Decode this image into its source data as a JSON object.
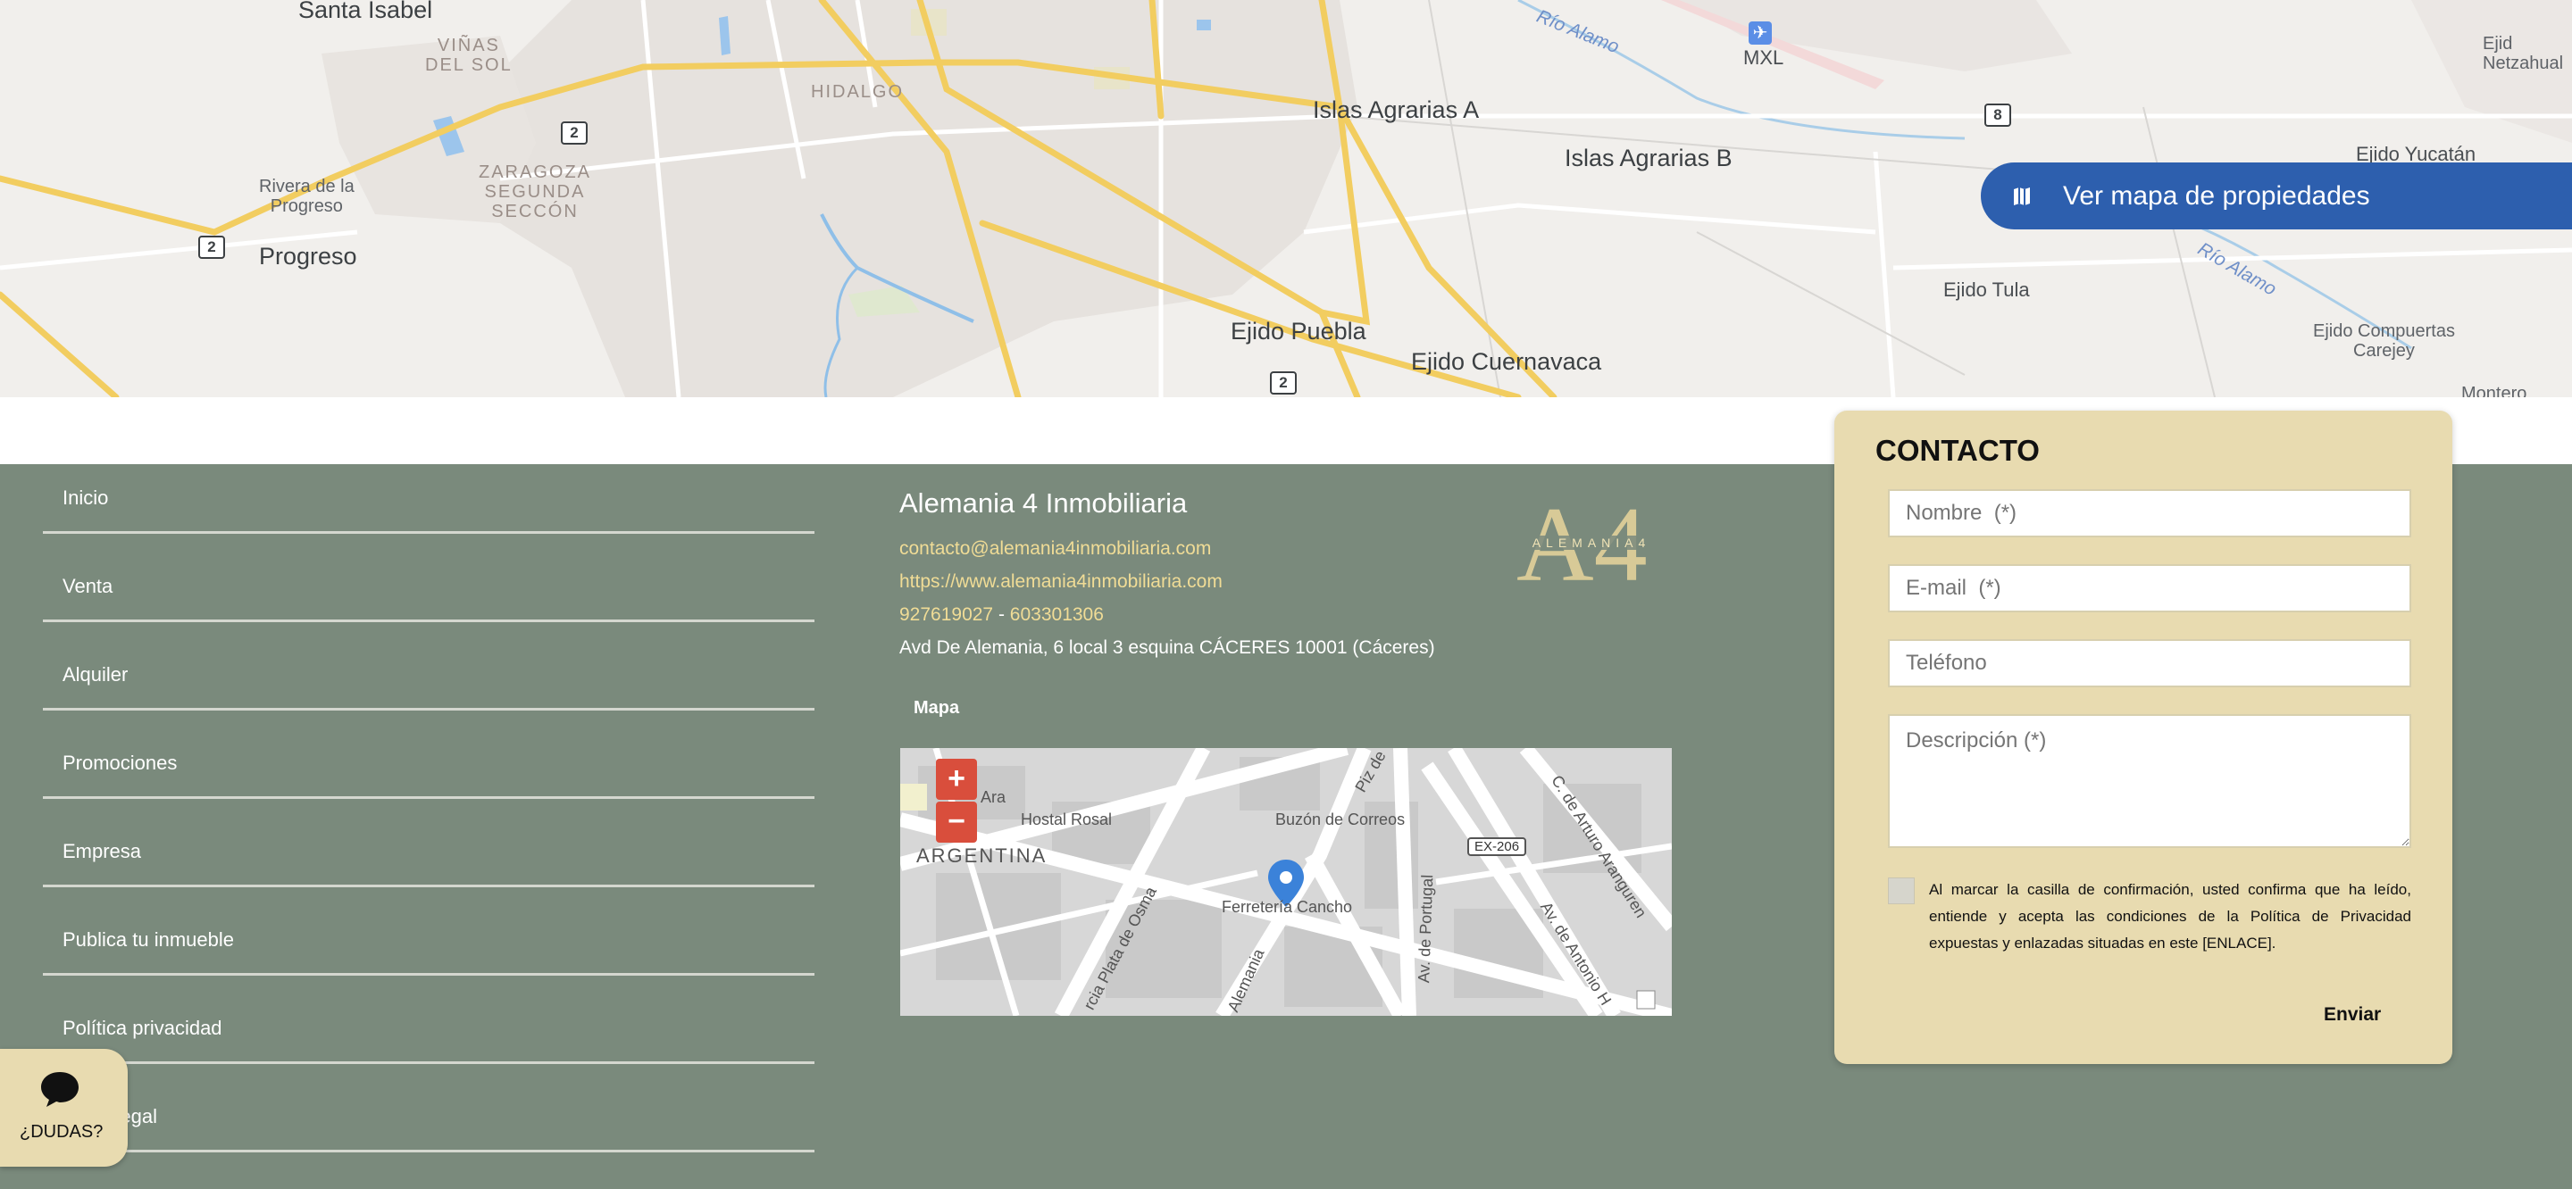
{
  "top_map": {
    "labels": {
      "santa_isabel": "Santa Isabel",
      "vinas_del_sol_1": "VIÑAS",
      "vinas_del_sol_2": "DEL SOL",
      "hidalgo": "HIDALGO",
      "rivera_1": "Rivera de la",
      "rivera_2": "Progreso",
      "zaragoza_1": "ZARAGOZA",
      "zaragoza_2": "SEGUNDA",
      "zaragoza_3": "SECCÓN",
      "progreso": "Progreso",
      "islas_a": "Islas Agrarias A",
      "islas_b": "Islas Agrarias B",
      "ejido_puebla": "Ejido Puebla",
      "ejido_cuernavaca": "Ejido Cuernavaca",
      "ejido_tula": "Ejido Tula",
      "ejido_yucatan": "Ejido Yucatán",
      "ejido_compuertas_1": "Ejido Compuertas",
      "ejido_compuertas_2": "Carejey",
      "ejido_netz_1": "Ejid",
      "ejido_netz_2": "Netzahual",
      "montero": "Montero",
      "mxl": "MXL",
      "rio_alamo_1": "Río Alamo",
      "rio_alamo_2": "Río Alamo"
    },
    "shields": {
      "s2a": "2",
      "s2b": "2",
      "s2c": "2",
      "s8": "8"
    },
    "map_button_label": "Ver mapa de propiedades"
  },
  "nav": {
    "items": [
      "Inicio",
      "Venta",
      "Alquiler",
      "Promociones",
      "Empresa",
      "Publica tu inmueble",
      "Política privacidad",
      "Aviso legal"
    ]
  },
  "company": {
    "name": "Alemania 4 Inmobiliaria",
    "email": "contacto@alemania4inmobiliaria.com",
    "website": "https://www.alemania4inmobiliaria.com",
    "phone1": "927619027",
    "phone_sep": " - ",
    "phone2": "603301306",
    "address": "Avd De Alemania, 6 local 3 esquina CÁCERES 10001 (Cáceres)",
    "logo_text": "ALEMANIA4",
    "logo_letters": "A4"
  },
  "mini_map": {
    "section_label": "Mapa",
    "labels": {
      "ara": "Ara",
      "hostal_rosal": "Hostal Rosal",
      "argentina": "ARGENTINA",
      "buzon": "Buzón de Correos",
      "ferreteria": "Ferretería Cancho",
      "plata_osma": "rcia Plata de Osma",
      "alemania": "Alemania",
      "portugal": "Av. de Portugal",
      "arturo": "C. de Arturo Aranguren",
      "antonio": "Av. de Antonio H",
      "piz": "Piz de",
      "ex206": "EX-206"
    },
    "zoom_in": "+",
    "zoom_out": "−"
  },
  "contact": {
    "title": "CONTACTO",
    "name_placeholder": "Nombre  (*)",
    "email_placeholder": "E-mail  (*)",
    "phone_placeholder": "Teléfono",
    "description_placeholder": "Descripción (*)",
    "legal_text": "Al marcar la casilla de confirmación, usted confirma que ha leído, entiende y acepta las condiciones de la Política de Privacidad expuestas y enlazadas situadas en este [ENLACE].",
    "send_label": "Enviar"
  },
  "chat": {
    "label": "¿DUDAS?"
  },
  "colors": {
    "footer_bg": "#7a8a7c",
    "contact_bg": "#e8dbb0",
    "button_blue": "#2d5fae",
    "link_gold": "#f0dc96",
    "zoom_red": "#d94e3c"
  }
}
